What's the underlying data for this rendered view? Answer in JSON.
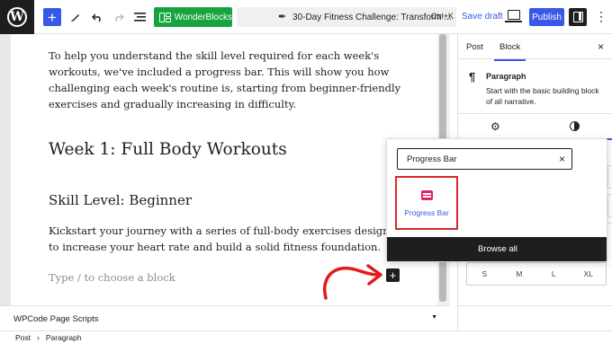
{
  "toolbar": {
    "wp_logo": "W",
    "add_icon": "+",
    "wonderblocks_label": "WonderBlocks",
    "doc_title": "30-Day Fitness Challenge: Transform ...",
    "shortcut": "Ctrl+K",
    "save_draft": "Save draft",
    "publish": "Publish",
    "more_icon": "⋮",
    "accent_color": "#3858e9",
    "wonderblocks_color": "#17a43e"
  },
  "content": {
    "para1": "To help you understand the skill level required for each week's workouts, we've included a progress bar. This will show you how challenging each week's routine is, starting from beginner-friendly exercises and gradually increasing in difficulty.",
    "heading_week": "Week 1: Full Body Workouts",
    "heading_skill": "Skill Level: Beginner",
    "para2": "Kickstart your journey with a series of full-body exercises designed to increase your heart rate and build a solid fitness foundation.",
    "placeholder": "Type / to choose a block",
    "inline_add": "+"
  },
  "inserter": {
    "search_value": "Progress Bar",
    "clear_icon": "×",
    "result_label": "Progress Bar",
    "browse_all": "Browse all",
    "highlight_color": "#d42b2b"
  },
  "sidebar": {
    "tab_post": "Post",
    "tab_block": "Block",
    "close_icon": "×",
    "block_icon": "¶",
    "block_name": "Paragraph",
    "block_desc": "Start with the basic building block of all narrative.",
    "gear_icon": "⚙",
    "more_icon": "⋮",
    "sizes": [
      "S",
      "M",
      "L",
      "XL"
    ]
  },
  "bottom": {
    "panel_title": "WPCode Page Scripts",
    "panel_caret": "▼",
    "breadcrumb": [
      "Post",
      "›",
      "Paragraph"
    ]
  }
}
